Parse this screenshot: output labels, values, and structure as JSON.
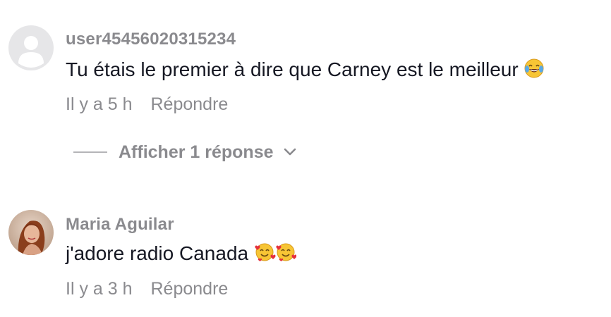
{
  "comments": [
    {
      "username": "user45456020315234",
      "text": "Tu étais le premier à dire que Carney est le meilleur",
      "emoji": "face-with-tears-of-joy-icon",
      "time": "Il y a 5 h",
      "reply_label": "Répondre",
      "view_replies_label": "Afficher 1 réponse"
    },
    {
      "username": "Maria Aguilar",
      "text": "j'adore radio Canada",
      "emoji": "smiling-face-with-hearts-icon",
      "time": "Il y a 3 h",
      "reply_label": "Répondre"
    }
  ],
  "colors": {
    "text_primary": "#161823",
    "text_secondary": "#8a8a8e",
    "avatar_default_bg": "#e6e6e8"
  }
}
